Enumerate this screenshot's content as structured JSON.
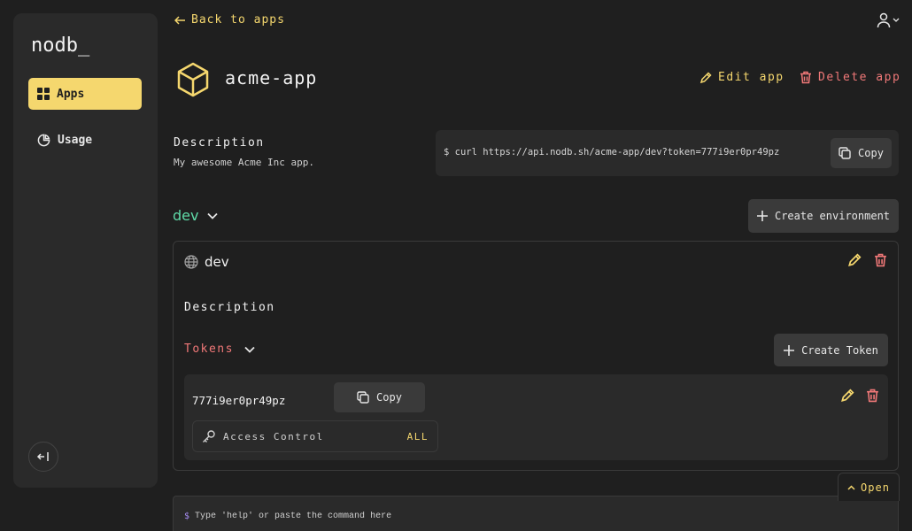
{
  "sidebar": {
    "logo": "nodb_",
    "items": [
      {
        "label": "Apps",
        "icon": "grid-icon",
        "active": true
      },
      {
        "label": "Usage",
        "icon": "pie-chart-icon",
        "active": false
      }
    ],
    "collapse_icon": "collapse-left-icon"
  },
  "header": {
    "back_label": "Back to apps",
    "user_icon": "user-icon"
  },
  "app": {
    "name": "acme-app",
    "edit_label": "Edit app",
    "delete_label": "Delete app",
    "description_label": "Description",
    "description": "My awesome Acme Inc app.",
    "curl_command": "$ curl https://api.nodb.sh/acme-app/dev?token=777i9er0pr49pz",
    "copy_label": "Copy"
  },
  "environment": {
    "selected": "dev",
    "create_label": "Create environment",
    "card": {
      "name": "dev",
      "description_label": "Description",
      "tokens_label": "Tokens",
      "create_token_label": "Create Token",
      "tokens": [
        {
          "value": "777i9er0pr49pz",
          "copy_label": "Copy",
          "access_label": "Access Control",
          "access_value": "ALL"
        }
      ]
    }
  },
  "terminal": {
    "open_label": "Open",
    "prompt": "$",
    "placeholder": "Type 'help' or paste the command here"
  },
  "colors": {
    "accent": "#f5d76e",
    "danger": "#f07878",
    "env": "#5fdba8",
    "background": "#1f1f1f",
    "panel": "#2a2a2a"
  }
}
